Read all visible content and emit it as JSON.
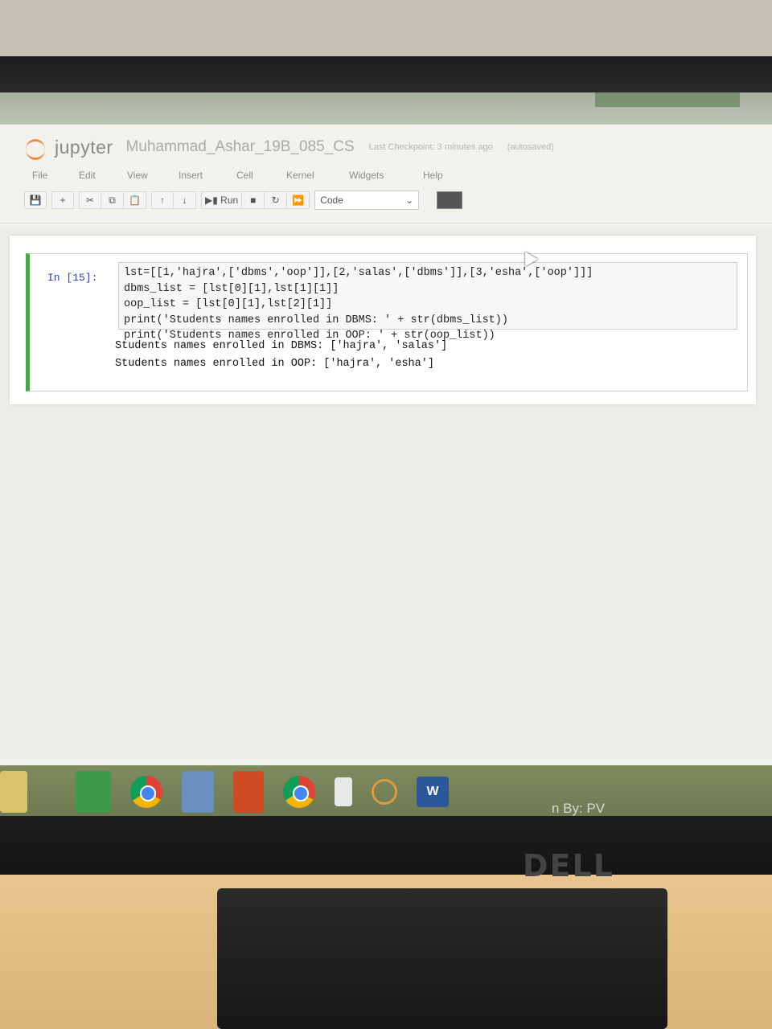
{
  "header": {
    "logo_text": "jupyter",
    "notebook_title": "Muhammad_Ashar_19B_085_CS",
    "checkpoint": "Last Checkpoint: 3 minutes ago",
    "autosave": "(autosaved)"
  },
  "menu": [
    "File",
    "Edit",
    "View",
    "Insert",
    "Cell",
    "Kernel",
    "Widgets",
    "Help"
  ],
  "toolbar": {
    "run_label": "Run",
    "cell_type": "Code"
  },
  "cell": {
    "prompt": "In [15]:",
    "code": [
      "lst=[[1,'hajra',['dbms','oop']],[2,'salas',['dbms']],[3,'esha',['oop']]]",
      "dbms_list = [lst[0][1],lst[1][1]]",
      "oop_list = [lst[0][1],lst[2][1]]",
      "print('Students names enrolled in DBMS: ' + str(dbms_list))",
      "print('Students names enrolled in OOP: ' + str(oop_list))"
    ],
    "output": [
      "Students names enrolled in DBMS: ['hajra', 'salas']",
      "Students names enrolled in OOP: ['hajra', 'esha']"
    ]
  },
  "watermark": "n By: PV",
  "brand": "DELL"
}
